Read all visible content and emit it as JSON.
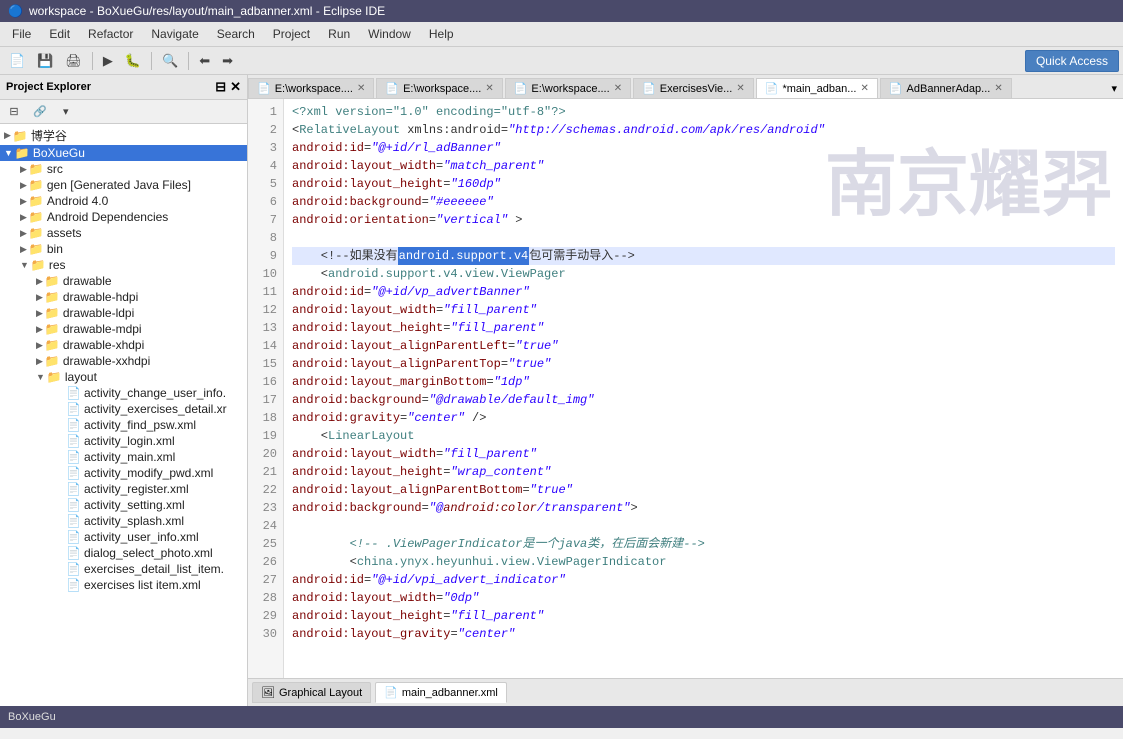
{
  "titleBar": {
    "icon": "🔵",
    "title": "workspace - BoXueGu/res/layout/main_adbanner.xml - Eclipse IDE"
  },
  "menuBar": {
    "items": [
      "File",
      "Edit",
      "Refactor",
      "Navigate",
      "Search",
      "Project",
      "Run",
      "Window",
      "Help"
    ]
  },
  "toolbar": {
    "quickAccessLabel": "Quick Access"
  },
  "sidebar": {
    "title": "Project Explorer",
    "closeLabel": "×",
    "items": [
      {
        "indent": 0,
        "arrow": "▶",
        "icon": "📁",
        "label": "博学谷",
        "level": 0
      },
      {
        "indent": 0,
        "arrow": "▼",
        "icon": "📁",
        "label": "BoXueGu",
        "level": 0,
        "selected": true
      },
      {
        "indent": 1,
        "arrow": "▶",
        "icon": "📁",
        "label": "src",
        "level": 1
      },
      {
        "indent": 1,
        "arrow": "▶",
        "icon": "📁",
        "label": "gen [Generated Java Files]",
        "level": 1
      },
      {
        "indent": 1,
        "arrow": "▶",
        "icon": "📁",
        "label": "Android 4.0",
        "level": 1
      },
      {
        "indent": 1,
        "arrow": "▶",
        "icon": "📁",
        "label": "Android Dependencies",
        "level": 1
      },
      {
        "indent": 1,
        "arrow": "▶",
        "icon": "📁",
        "label": "assets",
        "level": 1
      },
      {
        "indent": 1,
        "arrow": "▶",
        "icon": "📁",
        "label": "bin",
        "level": 1
      },
      {
        "indent": 1,
        "arrow": "▼",
        "icon": "📁",
        "label": "res",
        "level": 1
      },
      {
        "indent": 2,
        "arrow": "▶",
        "icon": "📁",
        "label": "drawable",
        "level": 2
      },
      {
        "indent": 2,
        "arrow": "▶",
        "icon": "📁",
        "label": "drawable-hdpi",
        "level": 2
      },
      {
        "indent": 2,
        "arrow": "▶",
        "icon": "📁",
        "label": "drawable-ldpi",
        "level": 2
      },
      {
        "indent": 2,
        "arrow": "▶",
        "icon": "📁",
        "label": "drawable-mdpi",
        "level": 2
      },
      {
        "indent": 2,
        "arrow": "▶",
        "icon": "📁",
        "label": "drawable-xhdpi",
        "level": 2
      },
      {
        "indent": 2,
        "arrow": "▶",
        "icon": "📁",
        "label": "drawable-xxhdpi",
        "level": 2
      },
      {
        "indent": 2,
        "arrow": "▼",
        "icon": "📁",
        "label": "layout",
        "level": 2
      },
      {
        "indent": 3,
        "arrow": "",
        "icon": "📄",
        "label": "activity_change_user_info.",
        "level": 3
      },
      {
        "indent": 3,
        "arrow": "",
        "icon": "📄",
        "label": "activity_exercises_detail.xr",
        "level": 3
      },
      {
        "indent": 3,
        "arrow": "",
        "icon": "📄",
        "label": "activity_find_psw.xml",
        "level": 3
      },
      {
        "indent": 3,
        "arrow": "",
        "icon": "📄",
        "label": "activity_login.xml",
        "level": 3
      },
      {
        "indent": 3,
        "arrow": "",
        "icon": "📄",
        "label": "activity_main.xml",
        "level": 3
      },
      {
        "indent": 3,
        "arrow": "",
        "icon": "📄",
        "label": "activity_modify_pwd.xml",
        "level": 3
      },
      {
        "indent": 3,
        "arrow": "",
        "icon": "📄",
        "label": "activity_register.xml",
        "level": 3
      },
      {
        "indent": 3,
        "arrow": "",
        "icon": "📄",
        "label": "activity_setting.xml",
        "level": 3
      },
      {
        "indent": 3,
        "arrow": "",
        "icon": "📄",
        "label": "activity_splash.xml",
        "level": 3
      },
      {
        "indent": 3,
        "arrow": "",
        "icon": "📄",
        "label": "activity_user_info.xml",
        "level": 3
      },
      {
        "indent": 3,
        "arrow": "",
        "icon": "📄",
        "label": "dialog_select_photo.xml",
        "level": 3
      },
      {
        "indent": 3,
        "arrow": "",
        "icon": "📄",
        "label": "exercises_detail_list_item.",
        "level": 3
      },
      {
        "indent": 3,
        "arrow": "",
        "icon": "📄",
        "label": "exercises list item.xml",
        "level": 3
      }
    ]
  },
  "tabs": [
    {
      "label": "E:\\workspace....",
      "icon": "📄",
      "active": false,
      "modified": false
    },
    {
      "label": "E:\\workspace....",
      "icon": "📄",
      "active": false,
      "modified": false
    },
    {
      "label": "E:\\workspace....",
      "icon": "📄",
      "active": false,
      "modified": false
    },
    {
      "label": "ExercisesVie...",
      "icon": "📄",
      "active": false,
      "modified": false
    },
    {
      "label": "*main_adban...",
      "icon": "📄",
      "active": true,
      "modified": true
    },
    {
      "label": "AdBannerAdap...",
      "icon": "📄",
      "active": false,
      "modified": false
    }
  ],
  "codeLines": [
    {
      "num": 1,
      "content": "<?xml version=\"1.0\" encoding=\"utf-8\"?>"
    },
    {
      "num": 2,
      "content": "<RelativeLayout xmlns:android=\"http://schemas.android.com/apk/res/android\""
    },
    {
      "num": 3,
      "content": "    android:id=\"@+id/rl_adBanner\""
    },
    {
      "num": 4,
      "content": "    android:layout_width=\"match_parent\""
    },
    {
      "num": 5,
      "content": "    android:layout_height=\"160dp\""
    },
    {
      "num": 6,
      "content": "    android:background=\"#eeeeee\""
    },
    {
      "num": 7,
      "content": "    android:orientation=\"vertical\" >"
    },
    {
      "num": 8,
      "content": ""
    },
    {
      "num": 9,
      "content": "    <!--如果没有android.support.v4包可需手动导入-->",
      "highlight": true
    },
    {
      "num": 10,
      "content": "    <android.support.v4.view.ViewPager"
    },
    {
      "num": 11,
      "content": "        android:id=\"@+id/vp_advertBanner\""
    },
    {
      "num": 12,
      "content": "        android:layout_width=\"fill_parent\""
    },
    {
      "num": 13,
      "content": "        android:layout_height=\"fill_parent\""
    },
    {
      "num": 14,
      "content": "        android:layout_alignParentLeft=\"true\""
    },
    {
      "num": 15,
      "content": "        android:layout_alignParentTop=\"true\""
    },
    {
      "num": 16,
      "content": "        android:layout_marginBottom=\"1dp\""
    },
    {
      "num": 17,
      "content": "        android:background=\"@drawable/default_img\""
    },
    {
      "num": 18,
      "content": "        android:gravity=\"center\" />"
    },
    {
      "num": 19,
      "content": "    <LinearLayout"
    },
    {
      "num": 20,
      "content": "        android:layout_width=\"fill_parent\""
    },
    {
      "num": 21,
      "content": "        android:layout_height=\"wrap_content\""
    },
    {
      "num": 22,
      "content": "        android:layout_alignParentBottom=\"true\""
    },
    {
      "num": 23,
      "content": "        android:background=\"@android:color/transparent\">"
    },
    {
      "num": 24,
      "content": ""
    },
    {
      "num": 25,
      "content": "        <!-- .ViewPagerIndicator是一个java类，在后面会新建-->"
    },
    {
      "num": 26,
      "content": "        <china.ynyx.heyunhui.view.ViewPagerIndicator"
    },
    {
      "num": 27,
      "content": "            android:id=\"@+id/vpi_advert_indicator\""
    },
    {
      "num": 28,
      "content": "            android:layout_width=\"0dp\""
    },
    {
      "num": 29,
      "content": "            android:layout_height=\"fill_parent\""
    },
    {
      "num": 30,
      "content": "            android:layout_gravity=\"center\""
    }
  ],
  "bottomTabs": [
    {
      "label": "Graphical Layout",
      "icon": "🖼",
      "active": false
    },
    {
      "label": "main_adbanner.xml",
      "icon": "📄",
      "active": true
    }
  ],
  "statusBar": {
    "text": "BoXueGu"
  }
}
